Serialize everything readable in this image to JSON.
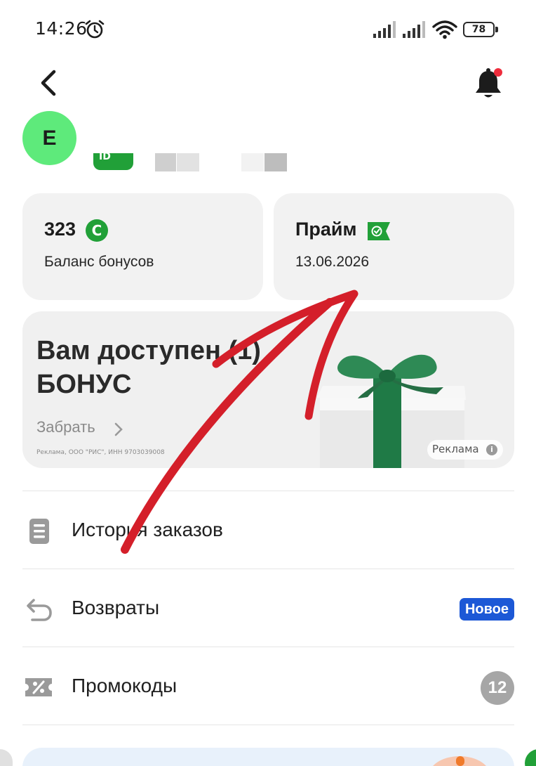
{
  "status_bar": {
    "time": "14:26",
    "battery": "78",
    "icons": [
      "alarm-icon",
      "signal-icon",
      "signal-icon",
      "wifi-icon",
      "battery-icon"
    ]
  },
  "header": {
    "back_icon": "chevron-left-icon",
    "notification_icon": "bell-icon",
    "notification_dot_color": "#ee2c3c"
  },
  "profile": {
    "avatar_letter": "Е",
    "avatar_color": "#5eea7b",
    "id_badge": "ID"
  },
  "cards": {
    "bonus": {
      "value": "323",
      "icon": "bonus-coin-icon",
      "icon_letter": "C",
      "label": "Баланс бонусов"
    },
    "prime": {
      "title": "Прайм",
      "icon": "prime-check-flag-icon",
      "date": "13.06.2026"
    }
  },
  "banner": {
    "title_line1": "Вам доступен (1)",
    "title_line2": "БОНУС",
    "cta": "Забрать",
    "legal": "Реклама, ООО \"РИС\", ИНН 9703039008",
    "ad_label": "Реклама",
    "ad_info": "i"
  },
  "menu": {
    "items": [
      {
        "label": "История заказов",
        "icon": "order-history-icon"
      },
      {
        "label": "Возвраты",
        "icon": "return-arrow-icon",
        "badge": "Новое"
      },
      {
        "label": "Промокоды",
        "icon": "promo-code-icon",
        "count": "12"
      }
    ]
  },
  "colors": {
    "brand_green": "#21a038",
    "badge_blue": "#1c58d6",
    "annotation_red": "#d41f2a",
    "card_bg": "#f2f2f2"
  }
}
